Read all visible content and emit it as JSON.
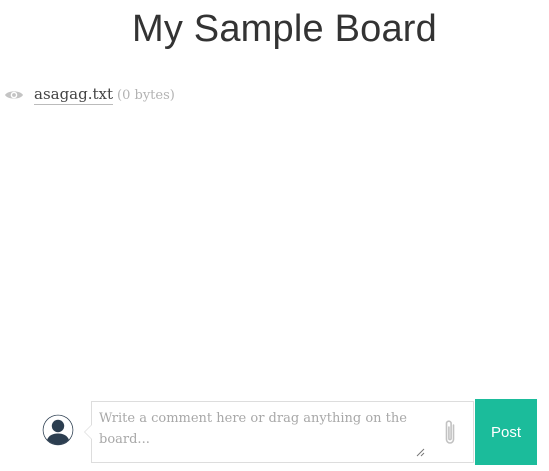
{
  "board": {
    "title": "My Sample Board"
  },
  "files": [
    {
      "name": "asagag.txt",
      "size": "(0 bytes)",
      "icon": "eye-icon"
    }
  ],
  "composer": {
    "placeholder": "Write a comment here or drag anything on the board...",
    "value": "",
    "avatar_icon": "user-avatar-icon",
    "attach_icon": "paperclip-icon",
    "post_label": "Post"
  },
  "colors": {
    "accent": "#1bbc9b",
    "title": "#333333",
    "muted": "#b3b3b3",
    "avatar": "#2c3e50"
  }
}
